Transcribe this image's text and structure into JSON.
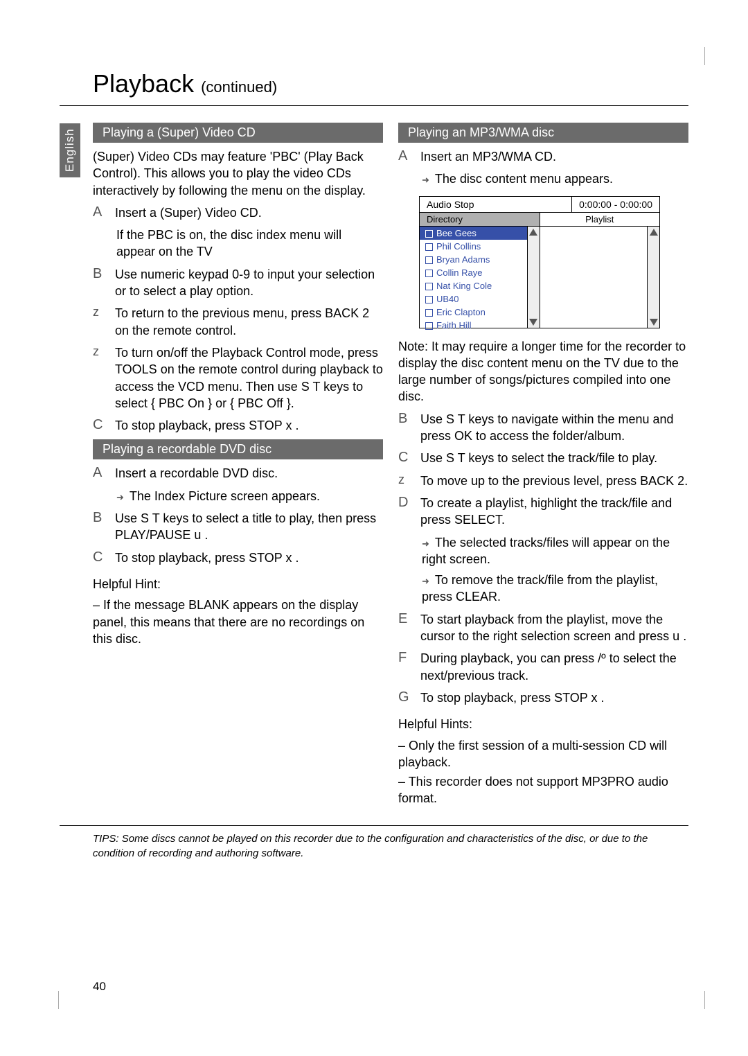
{
  "page": {
    "title": "Playback",
    "subtitle": "(continued)",
    "language_tab": "English",
    "page_number": "40"
  },
  "left": {
    "section1_head": "Playing a (Super) Video CD",
    "intro": "(Super) Video CDs may feature 'PBC' (Play Back Control). This allows you to play the video CDs interactively by following the menu on the display.",
    "stepA": "Insert a (Super) Video CD.",
    "stepA_note": "If the  PBC  is on, the disc index menu will appear on the TV",
    "stepB": "Use numeric keypad 0-9  to input your selection or to select a play option.",
    "z1": "To return to the previous menu, press BACK  2 on the remote control.",
    "z2": "To turn on/off the Playback Control mode, press TOOLS  on the remote control during playback to access the VCD menu. Then use  S T keys to select { PBC On } or { PBC Off }.",
    "stepC": "To stop playback, press STOP  x .",
    "section2_head": "Playing a recordable DVD disc",
    "r_stepA": "Insert a recordable DVD disc.",
    "r_stepA_sub": "The Index Picture screen appears.",
    "r_stepB": "Use  S T keys to select a title to play, then press PLAY/PAUSE  u  .",
    "r_stepC": "To stop playback, press STOP  x .",
    "hint_title": "Helpful Hint:",
    "hint_body": "If the message  BLANK  appears on the display panel, this means that there are no recordings on this disc."
  },
  "right": {
    "section_head": "Playing an MP3/WMA disc",
    "stepA": "Insert an MP3/WMA CD.",
    "stepA_sub": "The disc content menu appears.",
    "menu": {
      "status_left": "Audio Stop",
      "status_right": "0:00:00 - 0:00:00",
      "left_head": "Directory",
      "right_head": "Playlist",
      "items": [
        "Bee Gees",
        "Phil Collins",
        "Bryan Adams",
        "Collin Raye",
        "Nat King Cole",
        "UB40",
        "Eric Clapton",
        "Faith Hill"
      ]
    },
    "note": "Note:  It may require a longer time for the recorder to display the disc content menu on the TV due to the large number of songs/pictures compiled into one disc.",
    "stepB": "Use  S T keys to navigate within the menu and press OK  to access the folder/album.",
    "stepC": "Use  S T keys to select the track/file to play.",
    "z1": "To move up to the previous level, press BACK  2.",
    "stepD": "To create a playlist, highlight the track/file and press SELECT.",
    "stepD_sub1": "The selected tracks/files will appear on the right screen.",
    "stepD_sub2": "To remove the track/file from the playlist, press CLEAR.",
    "stepE": "To start playback from the playlist, move the cursor to the right selection screen and press u  .",
    "stepF": "During playback, you can press     /º    to select the next/previous track.",
    "stepG": "To stop playback, press STOP  x .",
    "hints_title": "Helpful Hints:",
    "hints_1": "Only the ﬁrst session of a multi-session CD will playback.",
    "hints_2": "This recorder does not support MP3PRO audio format."
  },
  "tips": {
    "label": "TIPS:",
    "text": "Some discs cannot be played on this recorder due to the configuration and characteristics of the disc, or due to the condition of recording and authoring software."
  }
}
